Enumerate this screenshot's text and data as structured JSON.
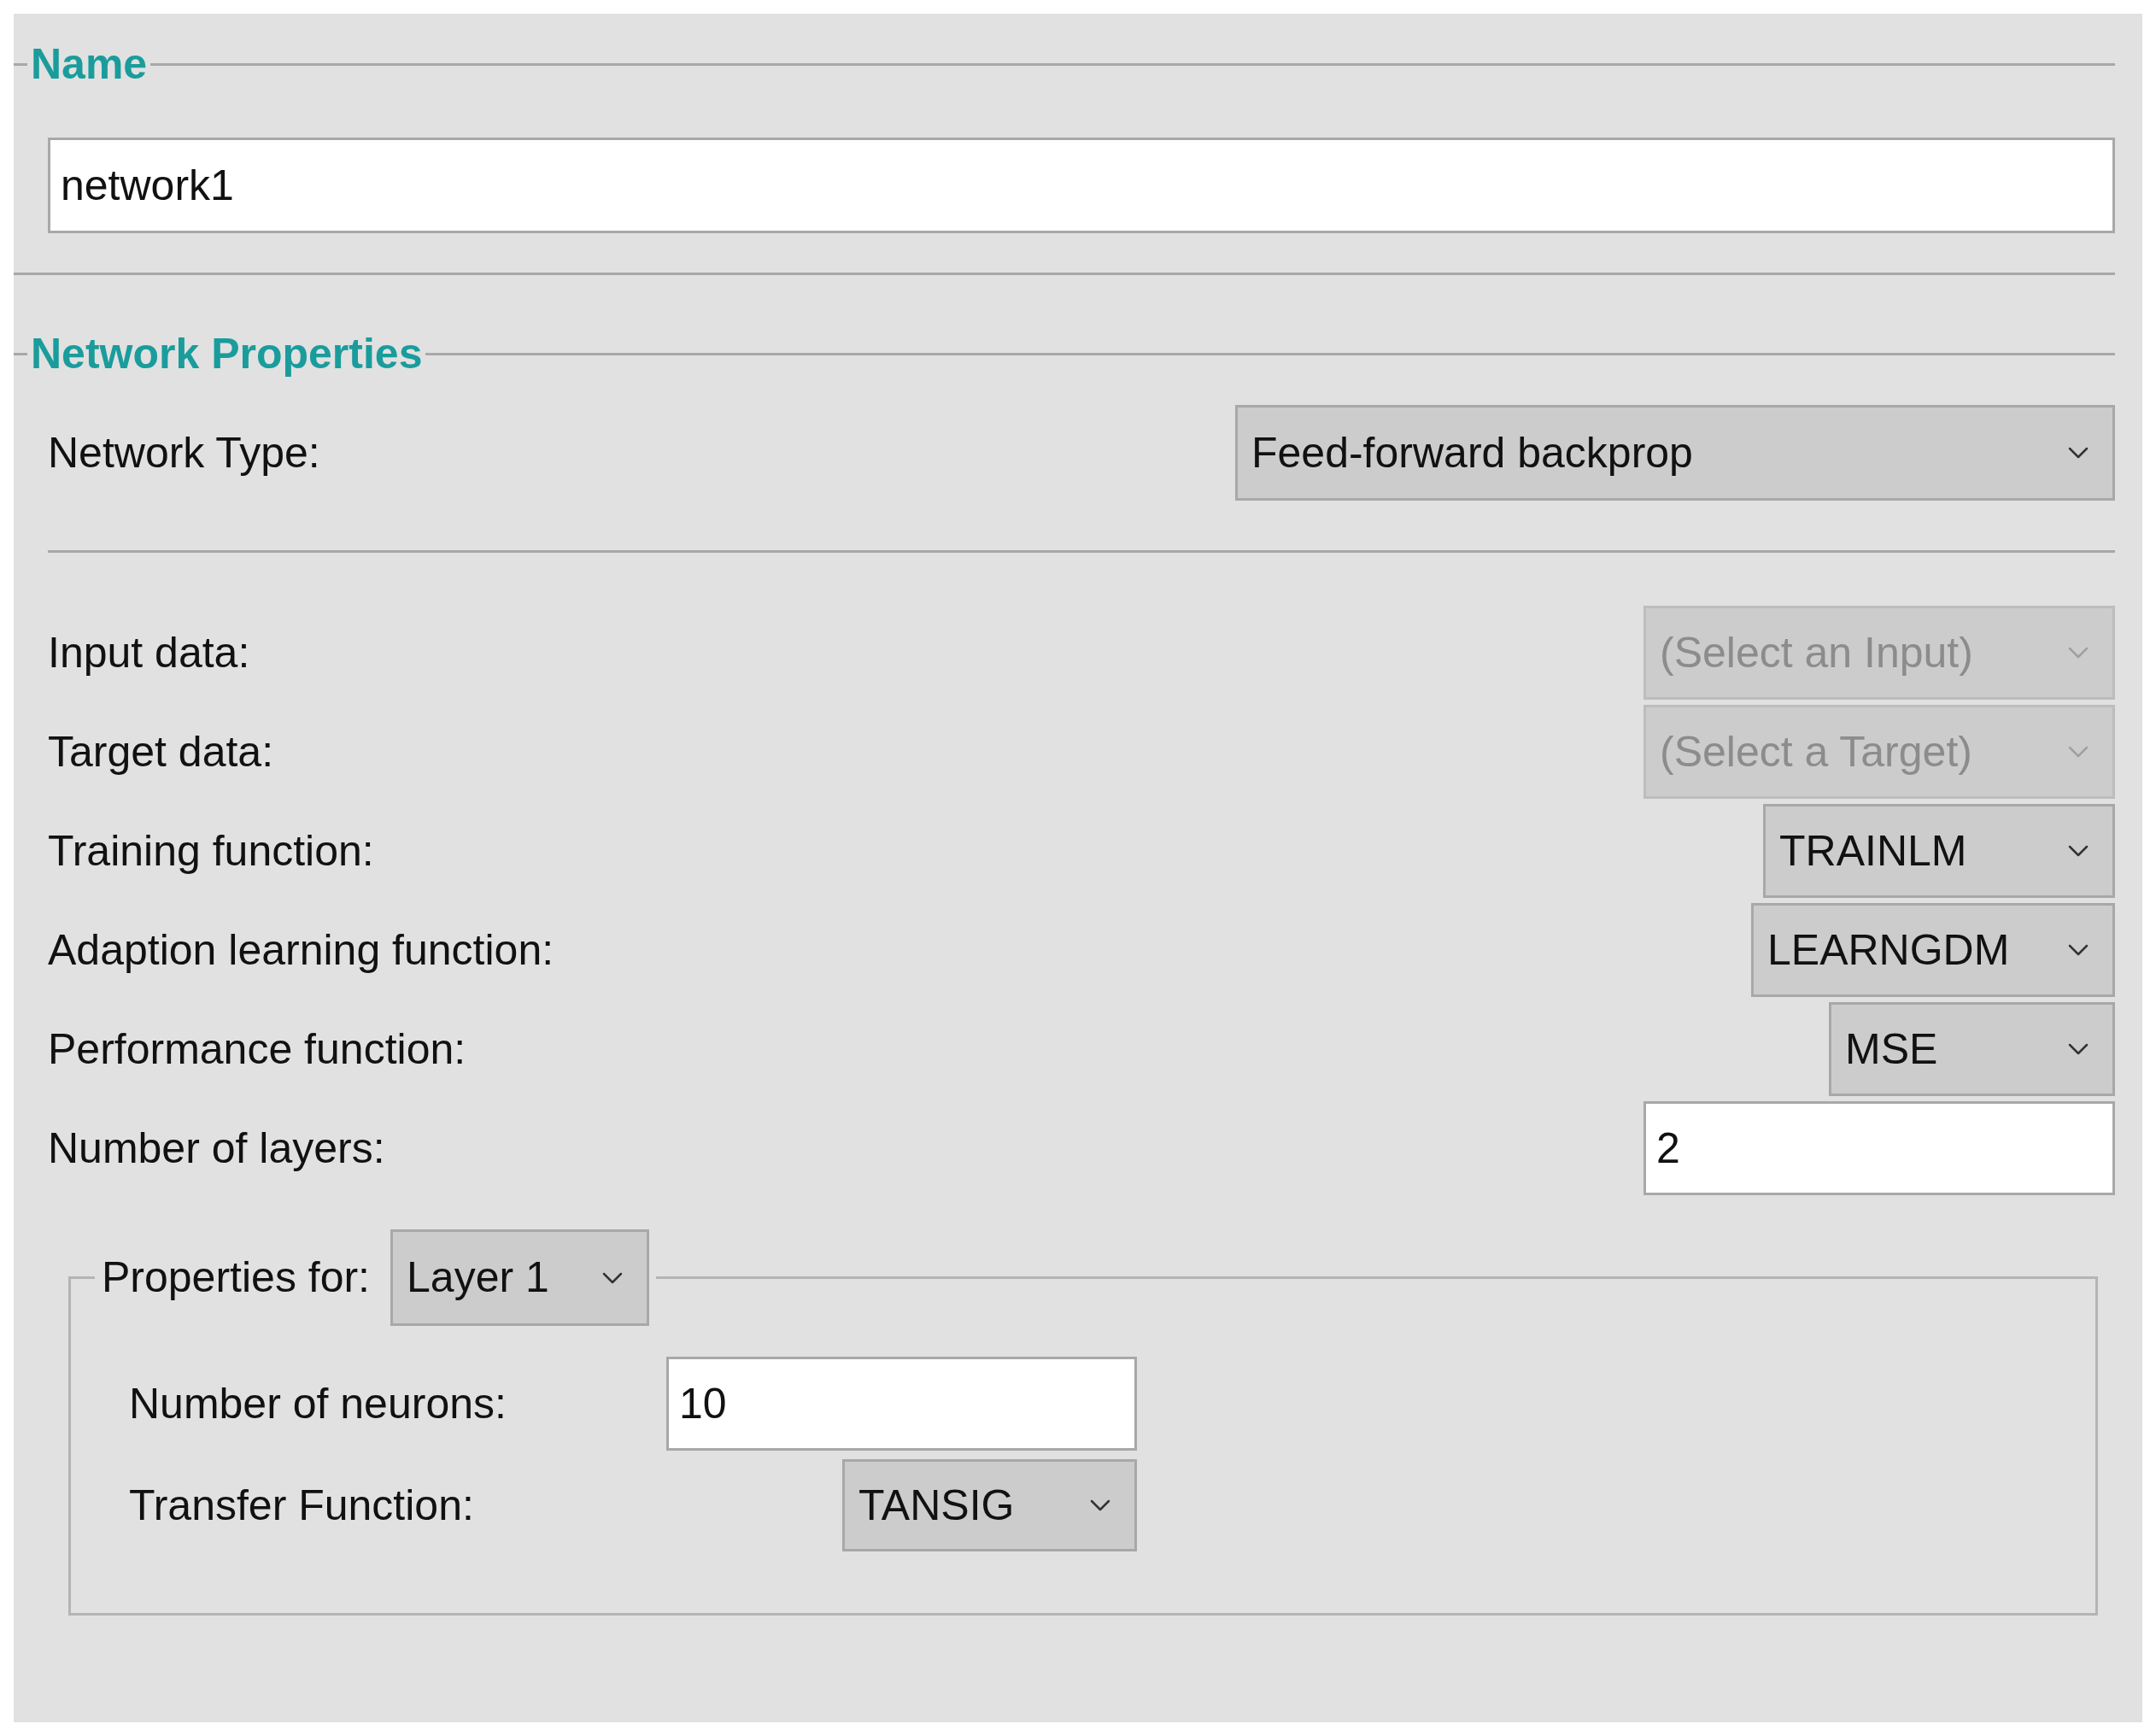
{
  "name_section": {
    "heading": "Name",
    "value": "network1"
  },
  "network_properties": {
    "heading": "Network Properties",
    "network_type": {
      "label": "Network Type:",
      "value": "Feed-forward backprop",
      "disabled": false
    },
    "fields": [
      {
        "kind": "dropdown",
        "label": "Input data:",
        "value": "(Select an Input)",
        "disabled": true
      },
      {
        "kind": "dropdown",
        "label": "Target data:",
        "value": "(Select a Target)",
        "disabled": true
      },
      {
        "kind": "dropdown",
        "label": "Training function:",
        "value": "TRAINLM",
        "disabled": false
      },
      {
        "kind": "dropdown",
        "label": "Adaption learning function:",
        "value": "LEARNGDM",
        "disabled": false
      },
      {
        "kind": "dropdown",
        "label": "Performance function:",
        "value": "MSE",
        "disabled": false
      },
      {
        "kind": "input",
        "label": "Number of layers:",
        "value": "2"
      }
    ],
    "layer_properties": {
      "label": "Properties for:",
      "layer": "Layer 1",
      "fields": [
        {
          "kind": "input",
          "label": "Number of neurons:",
          "value": "10"
        },
        {
          "kind": "dropdown",
          "label": "Transfer Function:",
          "value": "TANSIG",
          "disabled": false
        }
      ]
    }
  }
}
